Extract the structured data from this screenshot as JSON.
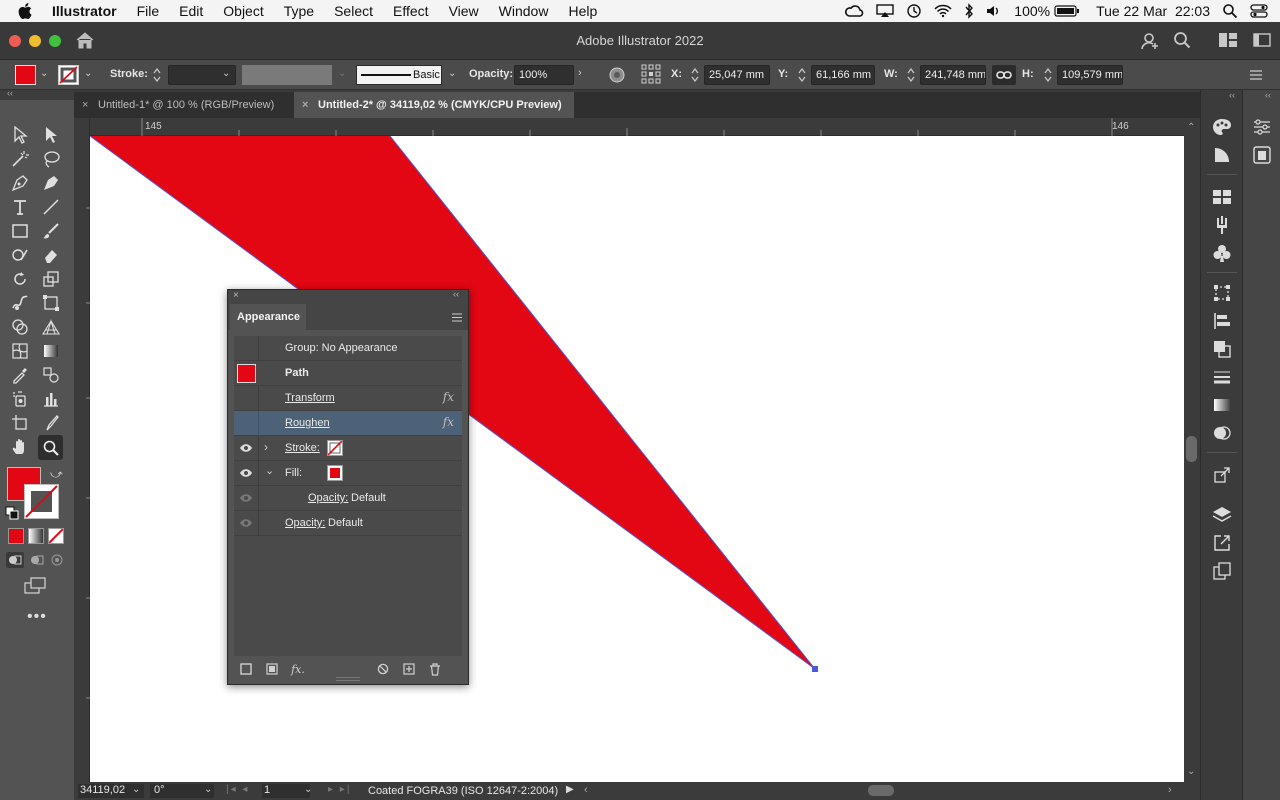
{
  "menubar": {
    "app_name": "Illustrator",
    "items": [
      "File",
      "Edit",
      "Object",
      "Type",
      "Select",
      "Effect",
      "View",
      "Window",
      "Help"
    ],
    "battery": "100%",
    "datetime": "Tue 22 Mar  22:03"
  },
  "window": {
    "title": "Adobe Illustrator 2022"
  },
  "control_bar": {
    "stroke_label": "Stroke:",
    "brush_label": "Basic",
    "opacity_label": "Opacity:",
    "opacity_value": "100%",
    "x_label": "X:",
    "x_value": "25,047 mm",
    "y_label": "Y:",
    "y_value": "61,166 mm",
    "w_label": "W:",
    "w_value": "241,748 mm",
    "h_label": "H:",
    "h_value": "109,579 mm"
  },
  "tabs": [
    {
      "label": "Untitled-1* @ 100 % (RGB/Preview)",
      "active": false
    },
    {
      "label": "Untitled-2* @ 34119,02 % (CMYK/CPU Preview)",
      "active": true
    }
  ],
  "ruler": {
    "left_tick": "145",
    "right_tick": "146"
  },
  "artwork": {
    "fill_color": "#e30613",
    "path_outline_color": "#4a5bd8"
  },
  "appearance_panel": {
    "title": "Appearance",
    "group_label": "Group: No Appearance",
    "path_label": "Path",
    "transform_label": "Transform",
    "roughen_label": "Roughen",
    "stroke_label": "Stroke:",
    "fill_label": "Fill:",
    "fill_opacity_label": "Opacity:",
    "fill_opacity_value": "Default",
    "opacity_label": "Opacity:",
    "opacity_value": "Default",
    "fill_color": "#e30613"
  },
  "status_bar": {
    "zoom": "34119,02",
    "rotation": "0°",
    "artboard": "1",
    "profile": "Coated FOGRA39 (ISO 12647-2:2004)"
  }
}
